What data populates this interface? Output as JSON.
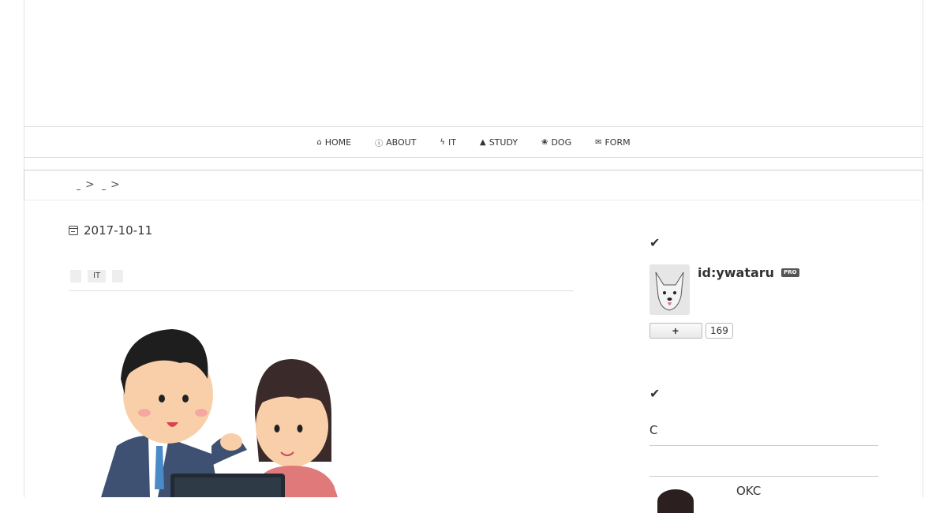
{
  "nav": {
    "items": [
      {
        "icon": "home-icon",
        "glyph": "⌂",
        "label": "HOME"
      },
      {
        "icon": "info-icon",
        "glyph": "ⓘ",
        "label": "ABOUT"
      },
      {
        "icon": "bolt-icon",
        "glyph": "ϟ",
        "label": "IT"
      },
      {
        "icon": "graduation-cap-icon",
        "glyph": "▲",
        "label": "STUDY"
      },
      {
        "icon": "paw-icon",
        "glyph": "❀",
        "label": "DOG"
      },
      {
        "icon": "envelope-icon",
        "glyph": "✉",
        "label": "FORM"
      }
    ]
  },
  "breadcrumb": {
    "sep": ">"
  },
  "article": {
    "date": "2017-10-11",
    "categories": [
      "",
      "IT",
      ""
    ]
  },
  "sidebar": {
    "profile": {
      "username": "id:ywataru",
      "badge": "PRO",
      "follow_label": "+",
      "follower_count": "169"
    },
    "section_heading": "C",
    "recent_title": "OKC"
  }
}
